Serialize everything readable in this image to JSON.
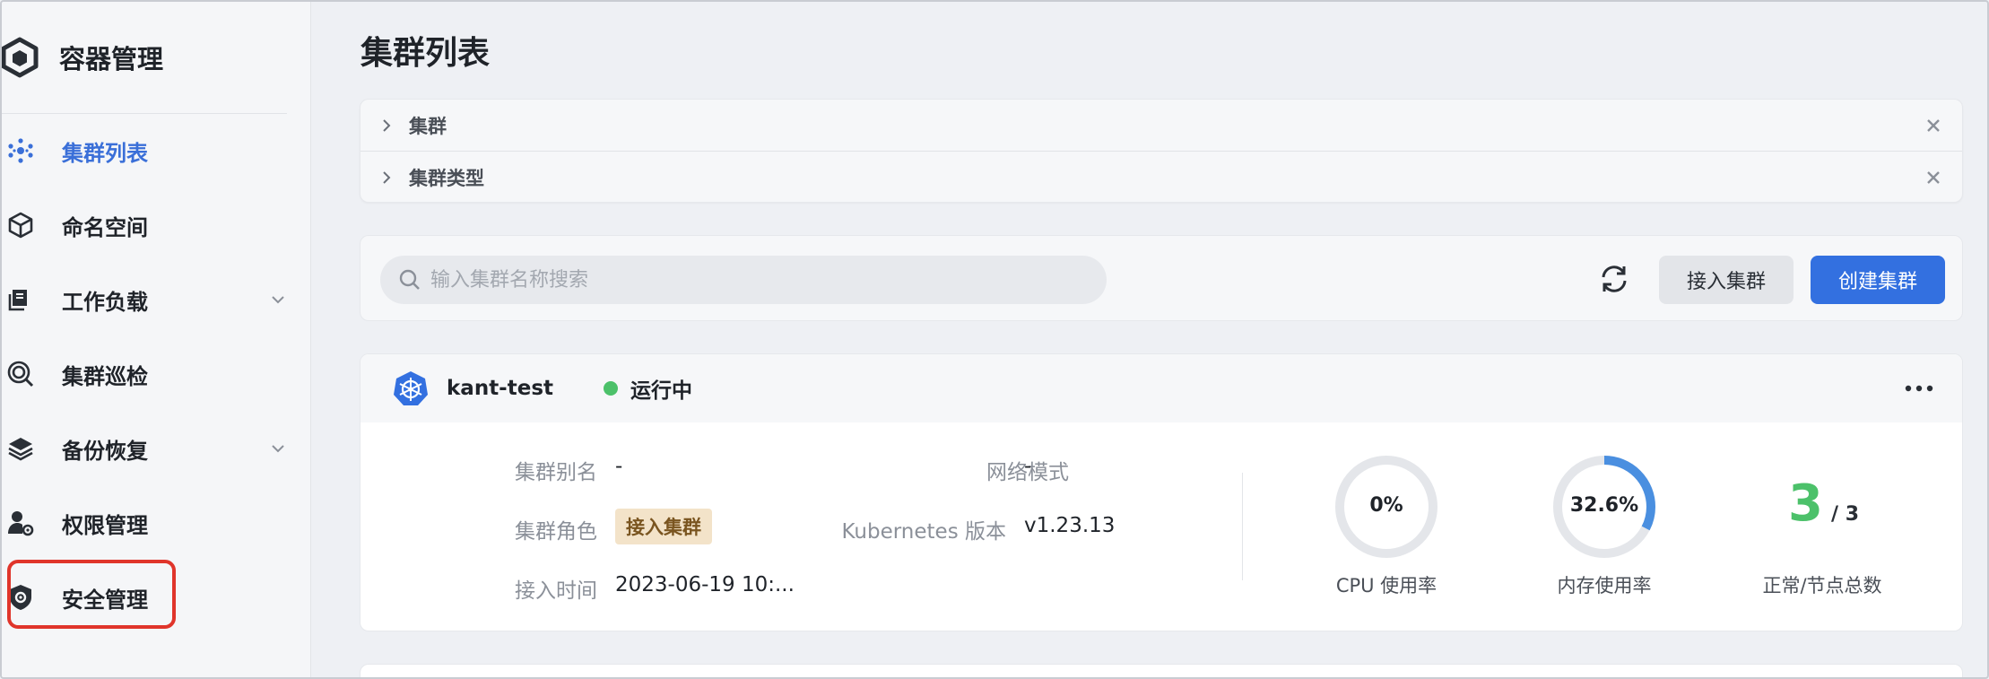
{
  "app": {
    "title": "容器管理"
  },
  "sidebar": {
    "items": [
      {
        "label": "集群列表",
        "icon": "cluster-list-icon",
        "active": true
      },
      {
        "label": "命名空间",
        "icon": "namespace-icon"
      },
      {
        "label": "工作负载",
        "icon": "workload-icon",
        "expandable": true
      },
      {
        "label": "集群巡检",
        "icon": "inspection-icon"
      },
      {
        "label": "备份恢复",
        "icon": "backup-icon",
        "expandable": true
      },
      {
        "label": "权限管理",
        "icon": "permission-icon"
      },
      {
        "label": "安全管理",
        "icon": "security-icon",
        "highlighted": true
      }
    ]
  },
  "page": {
    "title": "集群列表"
  },
  "filters": [
    {
      "label": "集群"
    },
    {
      "label": "集群类型"
    }
  ],
  "toolbar": {
    "search_placeholder": "输入集群名称搜索",
    "connect_label": "接入集群",
    "create_label": "创建集群"
  },
  "cluster": {
    "name": "kant-test",
    "status": "运行中",
    "alias_label": "集群别名",
    "alias_value": "-",
    "role_label": "集群角色",
    "role_value": "接入集群",
    "time_label": "接入时间",
    "time_value": "2023-06-19 10:...",
    "network_label": "网络模式",
    "network_value": "-",
    "k8s_label": "Kubernetes 版本",
    "k8s_value": "v1.23.13",
    "cpu_value": "0%",
    "cpu_fraction": 0,
    "cpu_label": "CPU 使用率",
    "mem_value": "32.6%",
    "mem_fraction": 0.326,
    "mem_label": "内存使用率",
    "nodes_ok": "3",
    "nodes_total": "/ 3",
    "nodes_label": "正常/节点总数"
  },
  "colors": {
    "accent": "#3370e0",
    "active_nav": "#3a6fd8",
    "status_ok": "#4cc16a",
    "gauge_track": "#e4e6ea",
    "gauge_fill": "#4a8fe0",
    "highlight": "#e0352b"
  }
}
